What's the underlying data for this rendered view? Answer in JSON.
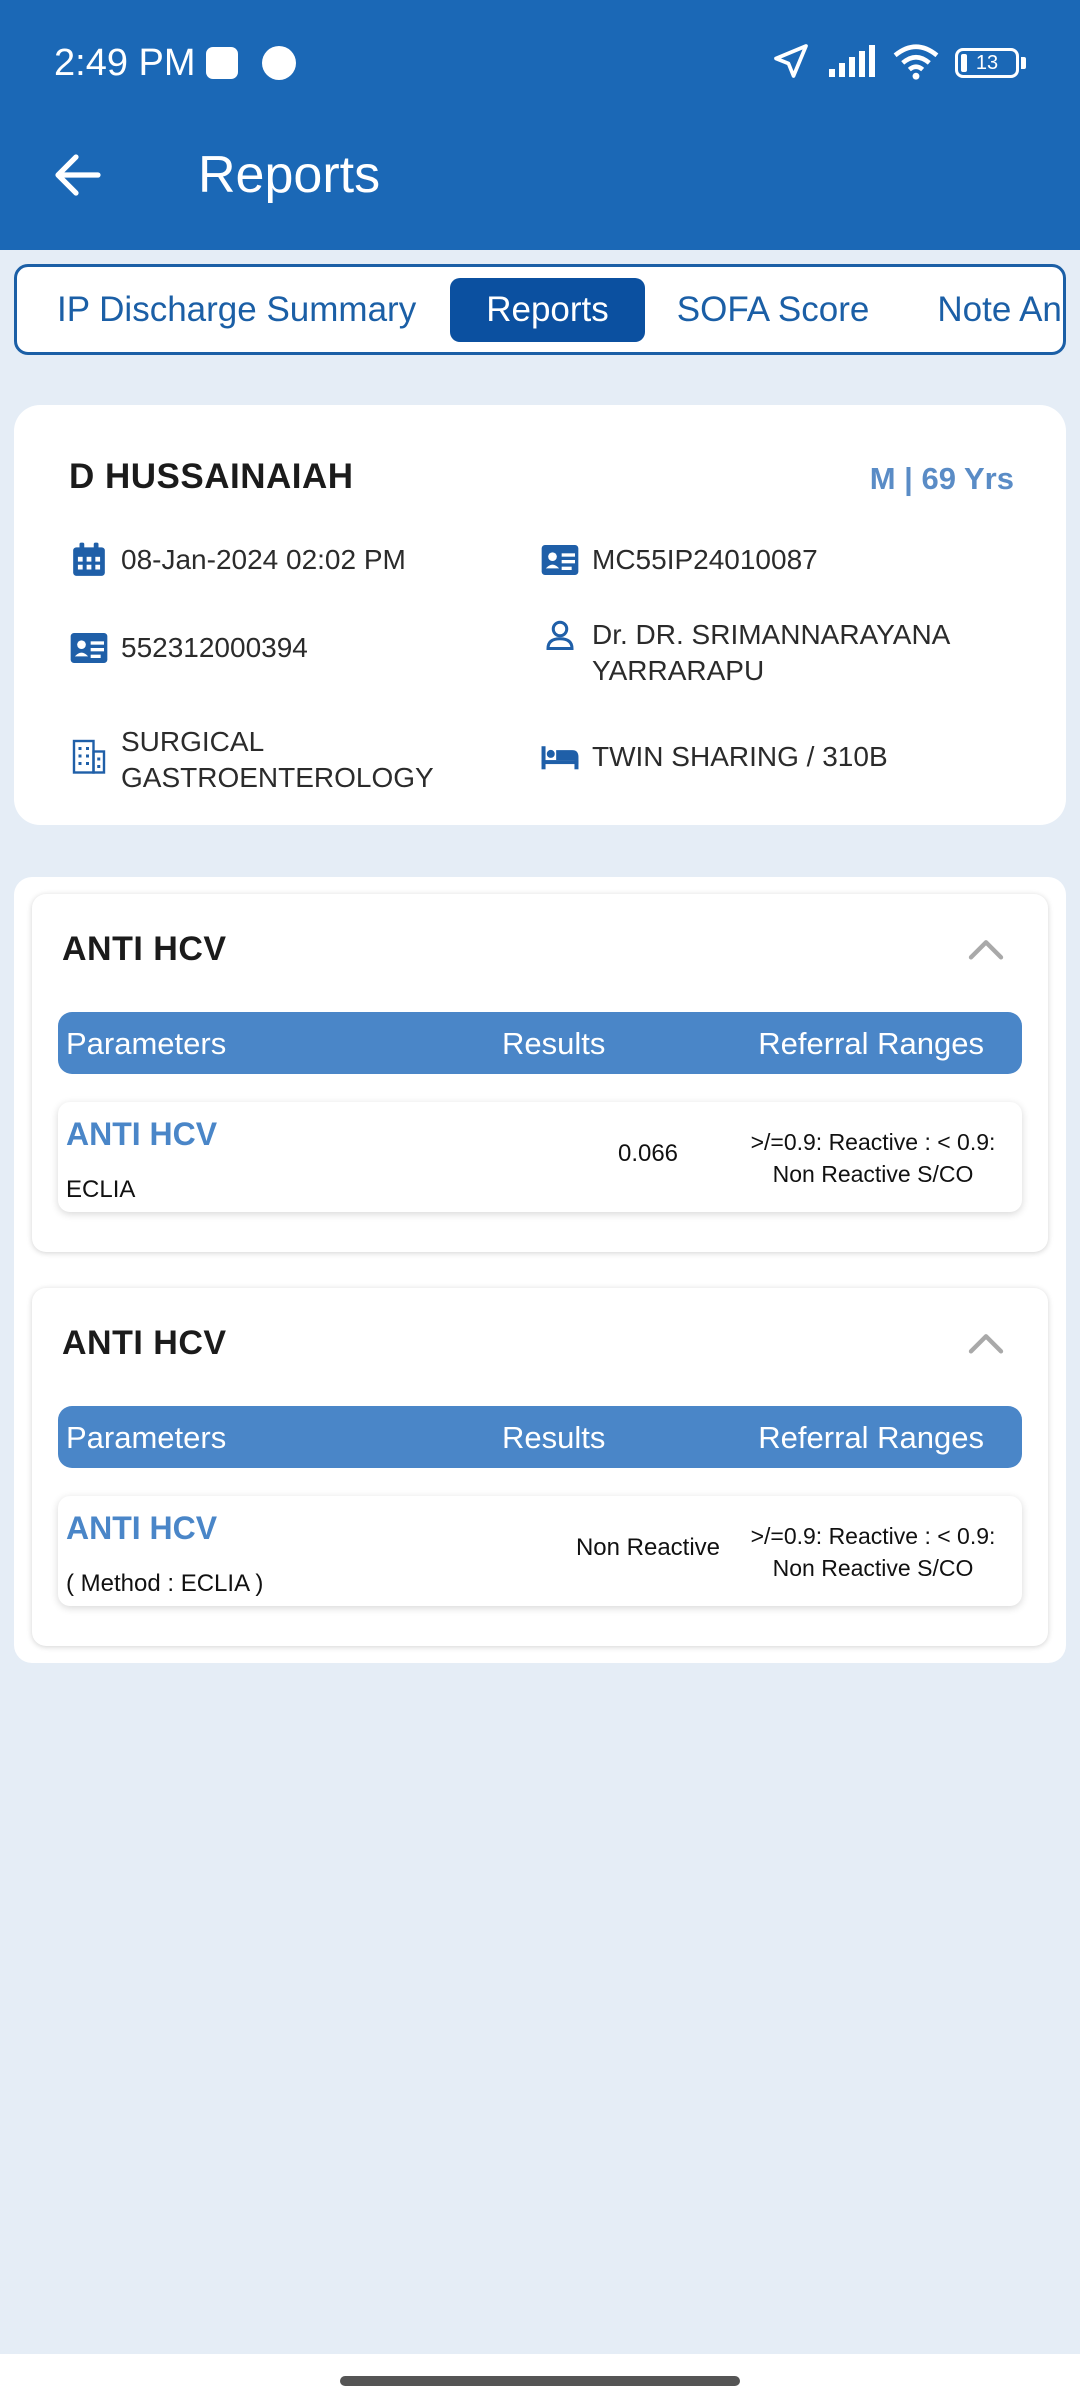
{
  "status_bar": {
    "time": "2:49 PM",
    "battery": "13"
  },
  "header": {
    "title": "Reports"
  },
  "tabs": [
    {
      "label": "IP Discharge Summary"
    },
    {
      "label": "Reports"
    },
    {
      "label": "SOFA Score"
    },
    {
      "label": "Note And"
    }
  ],
  "patient": {
    "name": "D HUSSAINAIAH",
    "gender_age": "M | 69 Yrs",
    "admission_datetime": "08-Jan-2024 02:02 PM",
    "ip_number": "MC55IP24010087",
    "patient_id": "552312000394",
    "doctor": "Dr. DR. SRIMANNARAYANA YARRARAPU",
    "department": "SURGICAL GASTROENTEROLOGY",
    "bed": "TWIN SHARING / 310B"
  },
  "table_headers": {
    "parameters": "Parameters",
    "results": "Results",
    "ranges": "Referral Ranges"
  },
  "reports": [
    {
      "title": "ANTI HCV",
      "parameter": "ANTI HCV",
      "method": "ECLIA",
      "result": "0.066",
      "range": ">/=0.9: Reactive : < 0.9: Non Reactive  S/CO"
    },
    {
      "title": "ANTI HCV",
      "parameter": "ANTI HCV",
      "method": "( Method : ECLIA )",
      "result": "Non Reactive",
      "range": ">/=0.9: Reactive : < 0.9: Non Reactive  S/CO"
    }
  ]
}
